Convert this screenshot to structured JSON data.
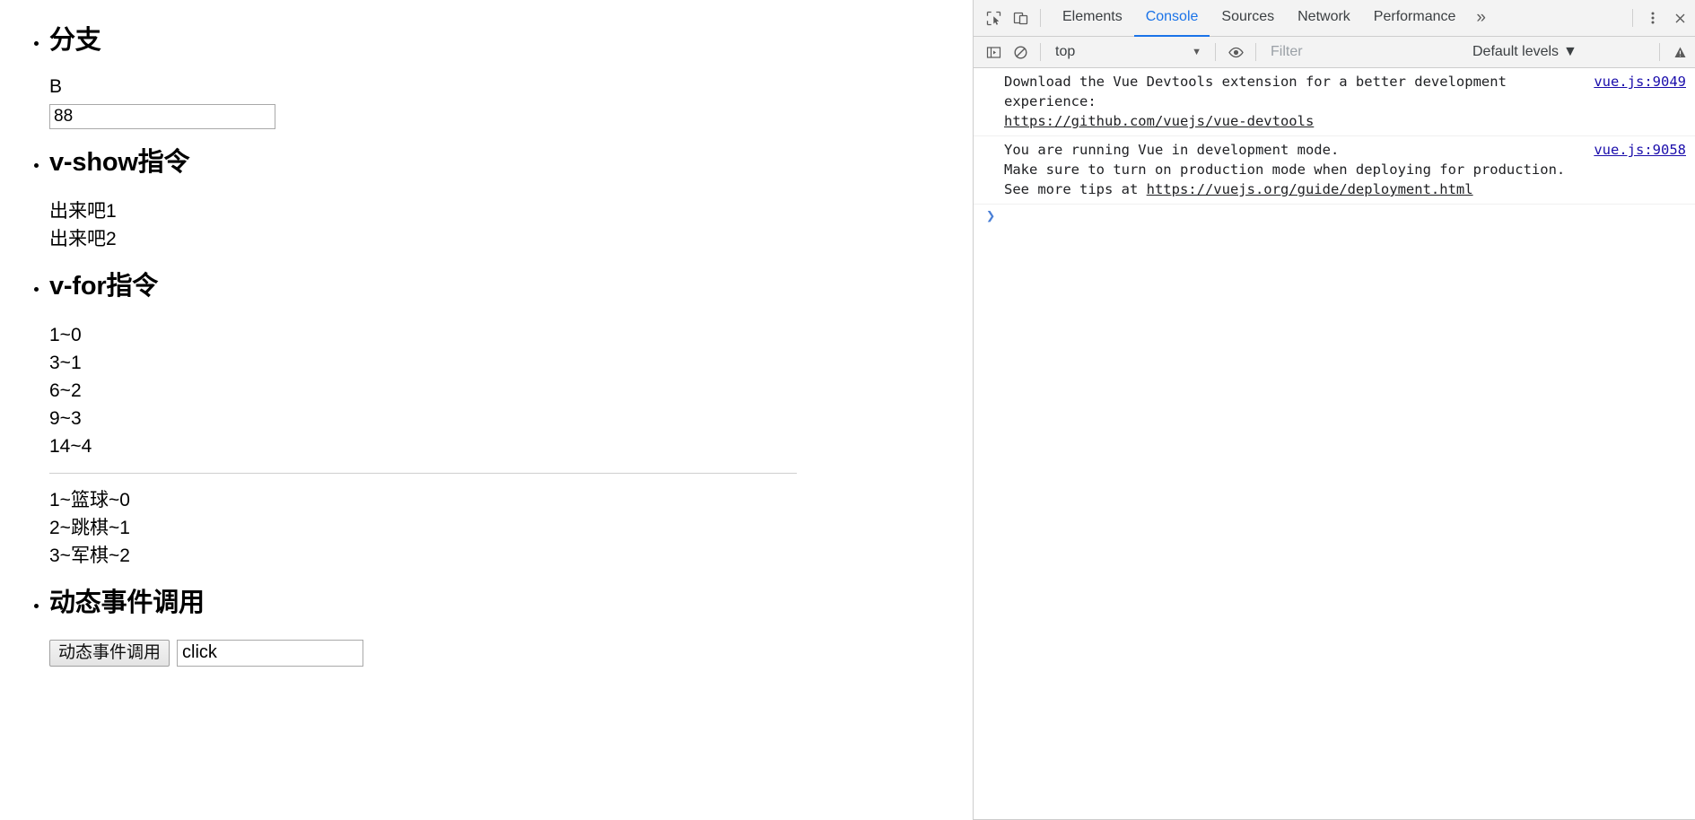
{
  "page": {
    "sections": [
      {
        "title": "分支",
        "label": "B",
        "input_value": "88",
        "input_placeholder": ""
      },
      {
        "title": "v-show指令",
        "lines": [
          "出来吧1",
          "出来吧2"
        ]
      },
      {
        "title": "v-for指令",
        "list1": [
          "1~0",
          "3~1",
          "6~2",
          "9~3",
          "14~4"
        ],
        "list2": [
          "1~篮球~0",
          "2~跳棋~1",
          "3~军棋~2"
        ]
      },
      {
        "title": "动态事件调用",
        "button_label": "动态事件调用",
        "input_value": "click",
        "input_placeholder": ""
      }
    ]
  },
  "devtools": {
    "icons": {
      "inspect": "inspect-element-icon",
      "device": "device-toolbar-icon",
      "more_tabs": "chevron-double-right-icon",
      "settings": "three-dots-menu-icon",
      "close": "close-icon",
      "sidebar": "console-sidebar-icon",
      "clear": "clear-console-icon",
      "eye": "live-expression-icon",
      "issues": "issues-icon"
    },
    "tabs": [
      {
        "label": "Elements",
        "active": false
      },
      {
        "label": "Console",
        "active": true
      },
      {
        "label": "Sources",
        "active": false
      },
      {
        "label": "Network",
        "active": false
      },
      {
        "label": "Performance",
        "active": false
      }
    ],
    "more_tabs_glyph": "»",
    "filterbar": {
      "context": "top",
      "context_caret": "▼",
      "filter_placeholder": "Filter",
      "filter_value": "",
      "levels_label": "Default levels",
      "levels_caret": "▼"
    },
    "messages": [
      {
        "pre_link": "Download the Vue Devtools extension for a better development\nexperience:\n",
        "link": "https://github.com/vuejs/vue-devtools",
        "post_link": "",
        "source": "vue.js:9049"
      },
      {
        "pre_link": "You are running Vue in development mode.\nMake sure to turn on production mode when deploying for production.\nSee more tips at ",
        "link": "https://vuejs.org/guide/deployment.html",
        "post_link": "",
        "source": "vue.js:9058"
      }
    ],
    "prompt": {
      "caret": "❯",
      "value": "",
      "placeholder": ""
    }
  },
  "colors": {
    "accent": "#1a73e8",
    "link": "#1a0dab",
    "toolbar_bg": "#f3f3f3",
    "border": "#cdcdcd",
    "prompt_caret": "#4a7fd6"
  }
}
